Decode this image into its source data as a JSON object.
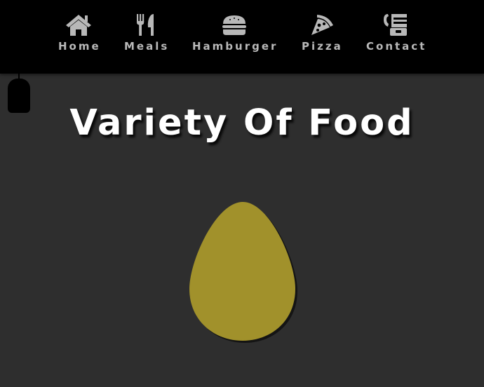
{
  "nav": {
    "items": [
      {
        "label": "Home",
        "icon": "home-icon"
      },
      {
        "label": "Meals",
        "icon": "utensils-icon"
      },
      {
        "label": "Hamburger",
        "icon": "hamburger-icon"
      },
      {
        "label": "Pizza",
        "icon": "pizza-icon"
      },
      {
        "label": "Contact",
        "icon": "phone-icon"
      }
    ]
  },
  "main": {
    "title": "Variety Of Food"
  },
  "colors": {
    "navbar_bg": "#000000",
    "page_bg": "#2e2e2e",
    "nav_text": "#b8b8b8",
    "title_text": "#ffffff",
    "egg_fill": "#a1912b"
  }
}
